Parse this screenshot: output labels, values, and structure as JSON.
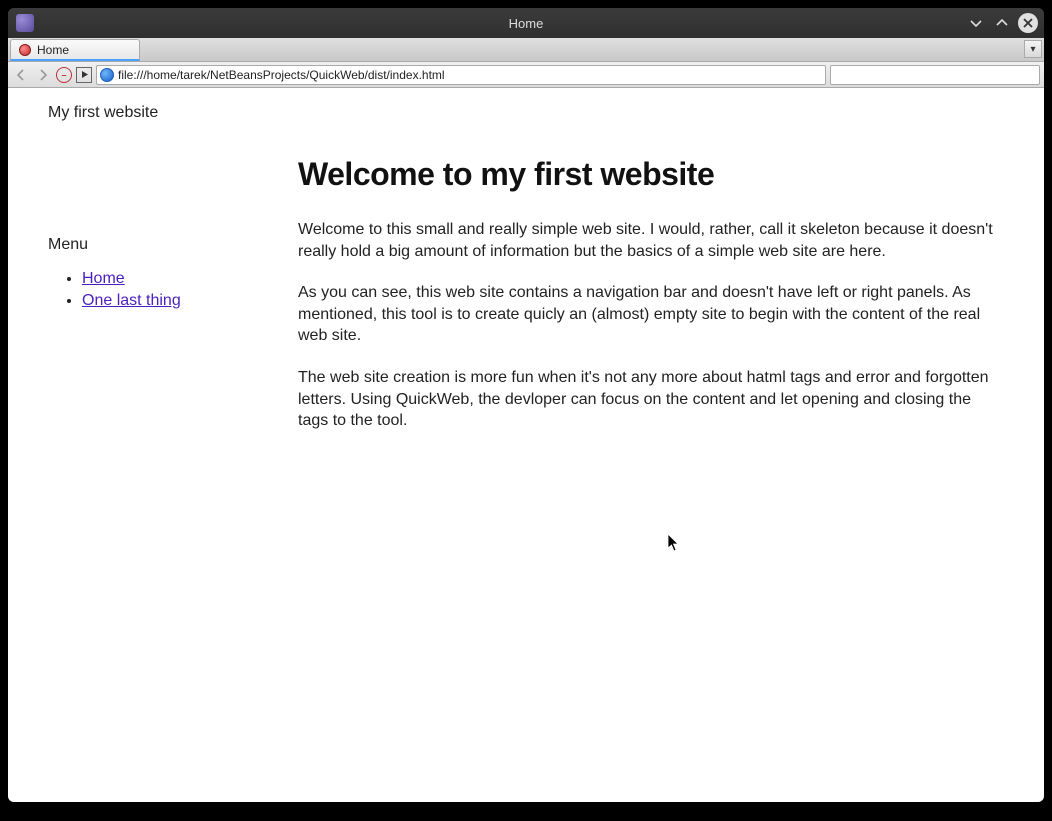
{
  "window": {
    "title": "Home"
  },
  "tab": {
    "label": "Home"
  },
  "urlbar": {
    "value": "file:///home/tarek/NetBeansProjects/QuickWeb/dist/index.html"
  },
  "page": {
    "header": "My first website",
    "menu_title": "Menu",
    "menu": [
      {
        "label": "Home"
      },
      {
        "label": "One last thing"
      }
    ],
    "h1": "Welcome to my first website",
    "paragraphs": [
      "Welcome to this small and really simple web site. I would, rather, call it skeleton because it doesn't really hold a big amount of information but the basics of a simple web site are here.",
      "As you can see, this web site contains a navigation bar and doesn't have left or right panels. As mentioned, this tool is to create quicly an (almost) empty site to begin with the content of the real web site.",
      "The web site creation is more fun when it's not any more about hatml tags and error and forgotten letters. Using QuickWeb, the devloper can focus on the content and let opening and closing the tags to the tool."
    ]
  }
}
